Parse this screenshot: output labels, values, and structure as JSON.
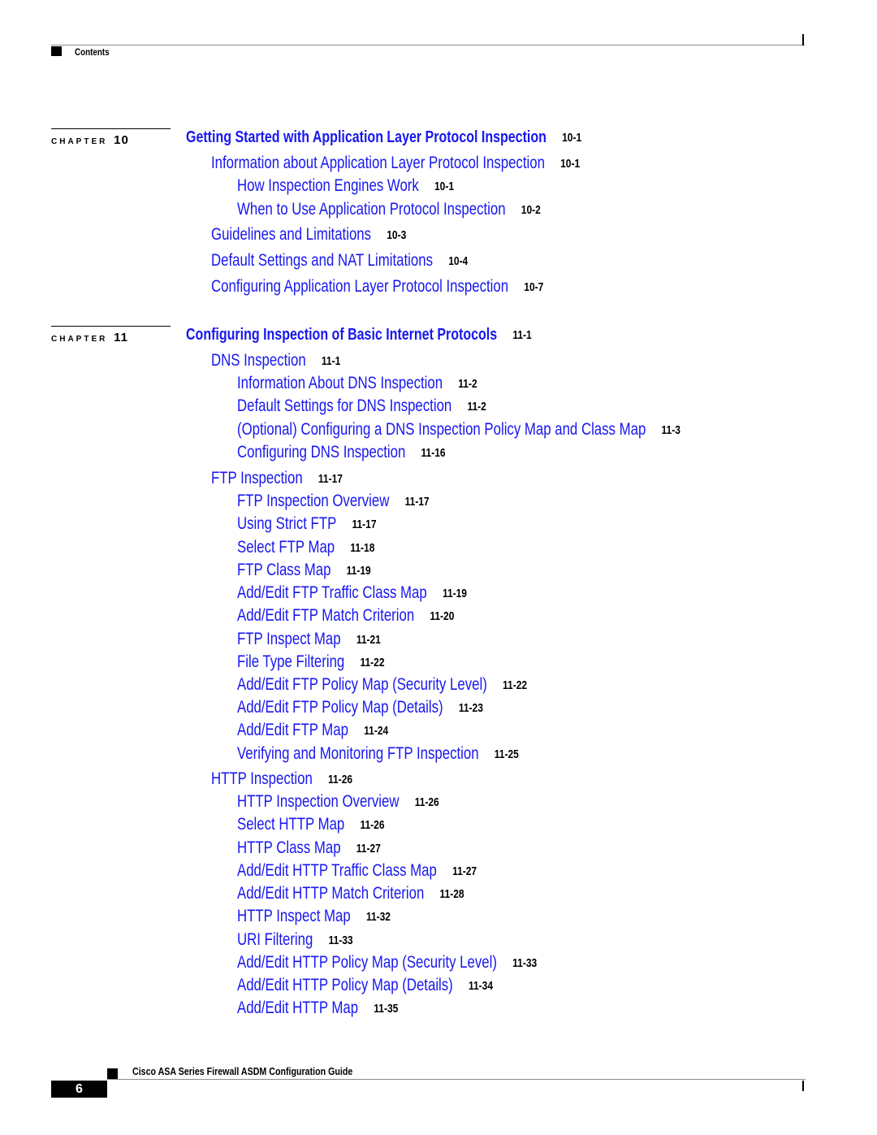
{
  "header": {
    "section_label": "Contents"
  },
  "chapters": [
    {
      "chapter_word": "CHAPTER",
      "number": "10",
      "entries": [
        {
          "level": 0,
          "title": "Getting Started with Application Layer Protocol Inspection",
          "page": "10-1"
        },
        {
          "level": 1,
          "title": "Information about Application Layer Protocol Inspection",
          "page": "10-1"
        },
        {
          "level": 2,
          "title": "How Inspection Engines Work",
          "page": "10-1"
        },
        {
          "level": 2,
          "title": "When to Use Application Protocol Inspection",
          "page": "10-2"
        },
        {
          "level": 1,
          "title": "Guidelines and Limitations",
          "page": "10-3"
        },
        {
          "level": 1,
          "title": "Default Settings and NAT Limitations",
          "page": "10-4"
        },
        {
          "level": 1,
          "title": "Configuring Application Layer Protocol Inspection",
          "page": "10-7"
        }
      ]
    },
    {
      "chapter_word": "CHAPTER",
      "number": "11",
      "entries": [
        {
          "level": 0,
          "title": "Configuring Inspection of Basic Internet Protocols",
          "page": "11-1"
        },
        {
          "level": 1,
          "title": "DNS Inspection",
          "page": "11-1"
        },
        {
          "level": 2,
          "title": "Information About DNS Inspection",
          "page": "11-2"
        },
        {
          "level": 2,
          "title": "Default Settings for DNS Inspection",
          "page": "11-2"
        },
        {
          "level": 2,
          "title": "(Optional) Configuring a DNS Inspection Policy Map and Class Map",
          "page": "11-3"
        },
        {
          "level": 2,
          "title": "Configuring DNS Inspection",
          "page": "11-16"
        },
        {
          "level": 1,
          "title": "FTP Inspection",
          "page": "11-17"
        },
        {
          "level": 2,
          "title": "FTP Inspection Overview",
          "page": "11-17"
        },
        {
          "level": 2,
          "title": "Using Strict FTP",
          "page": "11-17"
        },
        {
          "level": 2,
          "title": "Select FTP Map",
          "page": "11-18"
        },
        {
          "level": 2,
          "title": "FTP Class Map",
          "page": "11-19"
        },
        {
          "level": 2,
          "title": "Add/Edit FTP Traffic Class Map",
          "page": "11-19"
        },
        {
          "level": 2,
          "title": "Add/Edit FTP Match Criterion",
          "page": "11-20"
        },
        {
          "level": 2,
          "title": "FTP Inspect Map",
          "page": "11-21"
        },
        {
          "level": 2,
          "title": "File Type Filtering",
          "page": "11-22"
        },
        {
          "level": 2,
          "title": "Add/Edit FTP Policy Map (Security Level)",
          "page": "11-22"
        },
        {
          "level": 2,
          "title": "Add/Edit FTP Policy Map (Details)",
          "page": "11-23"
        },
        {
          "level": 2,
          "title": "Add/Edit FTP Map",
          "page": "11-24"
        },
        {
          "level": 2,
          "title": "Verifying and Monitoring FTP Inspection",
          "page": "11-25"
        },
        {
          "level": 1,
          "title": "HTTP Inspection",
          "page": "11-26"
        },
        {
          "level": 2,
          "title": "HTTP Inspection Overview",
          "page": "11-26"
        },
        {
          "level": 2,
          "title": "Select HTTP Map",
          "page": "11-26"
        },
        {
          "level": 2,
          "title": "HTTP Class Map",
          "page": "11-27"
        },
        {
          "level": 2,
          "title": "Add/Edit HTTP Traffic Class Map",
          "page": "11-27"
        },
        {
          "level": 2,
          "title": "Add/Edit HTTP Match Criterion",
          "page": "11-28"
        },
        {
          "level": 2,
          "title": "HTTP Inspect Map",
          "page": "11-32"
        },
        {
          "level": 2,
          "title": "URI Filtering",
          "page": "11-33"
        },
        {
          "level": 2,
          "title": "Add/Edit HTTP Policy Map (Security Level)",
          "page": "11-33"
        },
        {
          "level": 2,
          "title": "Add/Edit HTTP Policy Map (Details)",
          "page": "11-34"
        },
        {
          "level": 2,
          "title": "Add/Edit HTTP Map",
          "page": "11-35"
        }
      ]
    }
  ],
  "footer": {
    "book_title": "Cisco ASA Series Firewall ASDM Configuration Guide",
    "page_number": "6"
  },
  "colors": {
    "link": "#1717f0",
    "page_ref": "#000000"
  }
}
